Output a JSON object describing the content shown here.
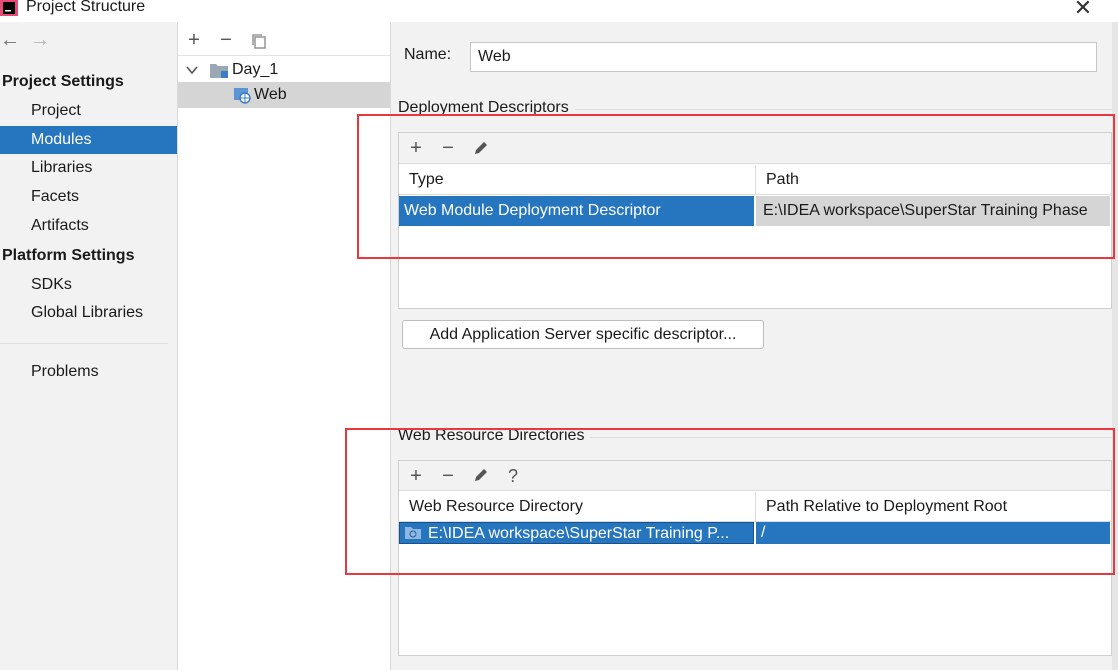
{
  "window": {
    "title": "Project Structure",
    "close_glyph": "✕"
  },
  "sidebar": {
    "back_glyph": "←",
    "forward_glyph": "→",
    "project_settings_header": "Project Settings",
    "project_items": [
      {
        "label": "Project"
      },
      {
        "label": "Modules",
        "selected": true
      },
      {
        "label": "Libraries"
      },
      {
        "label": "Facets"
      },
      {
        "label": "Artifacts"
      }
    ],
    "platform_settings_header": "Platform Settings",
    "platform_items": [
      {
        "label": "SDKs"
      },
      {
        "label": "Global Libraries"
      }
    ],
    "problems_label": "Problems"
  },
  "tree": {
    "toolbar": {
      "add": "+",
      "remove": "−",
      "copy": "copy-icon"
    },
    "root": {
      "label": "Day_1",
      "expanded": true
    },
    "child": {
      "label": "Web",
      "selected": true
    }
  },
  "detail": {
    "name_label": "Name:",
    "name_value": "Web",
    "deployment": {
      "title": "Deployment Descriptors",
      "toolbar": {
        "add": "+",
        "remove": "−",
        "edit": "pencil-icon"
      },
      "columns": [
        "Type",
        "Path"
      ],
      "rows": [
        {
          "type": "Web Module Deployment Descriptor",
          "path": "E:\\IDEA workspace\\SuperStar Training Phase"
        }
      ]
    },
    "add_server_button": "Add Application Server specific descriptor...",
    "web_resources": {
      "title": "Web Resource Directories",
      "toolbar": {
        "add": "+",
        "remove": "−",
        "edit": "pencil-icon",
        "help": "?"
      },
      "columns": [
        "Web Resource Directory",
        "Path Relative to Deployment Root"
      ],
      "rows": [
        {
          "directory": "E:\\IDEA workspace\\SuperStar Training P...",
          "relative_path": "/"
        }
      ]
    }
  },
  "colors": {
    "selection": "#2675bf",
    "highlight_border": "#e8383d",
    "panel_bg": "#f2f2f2"
  }
}
